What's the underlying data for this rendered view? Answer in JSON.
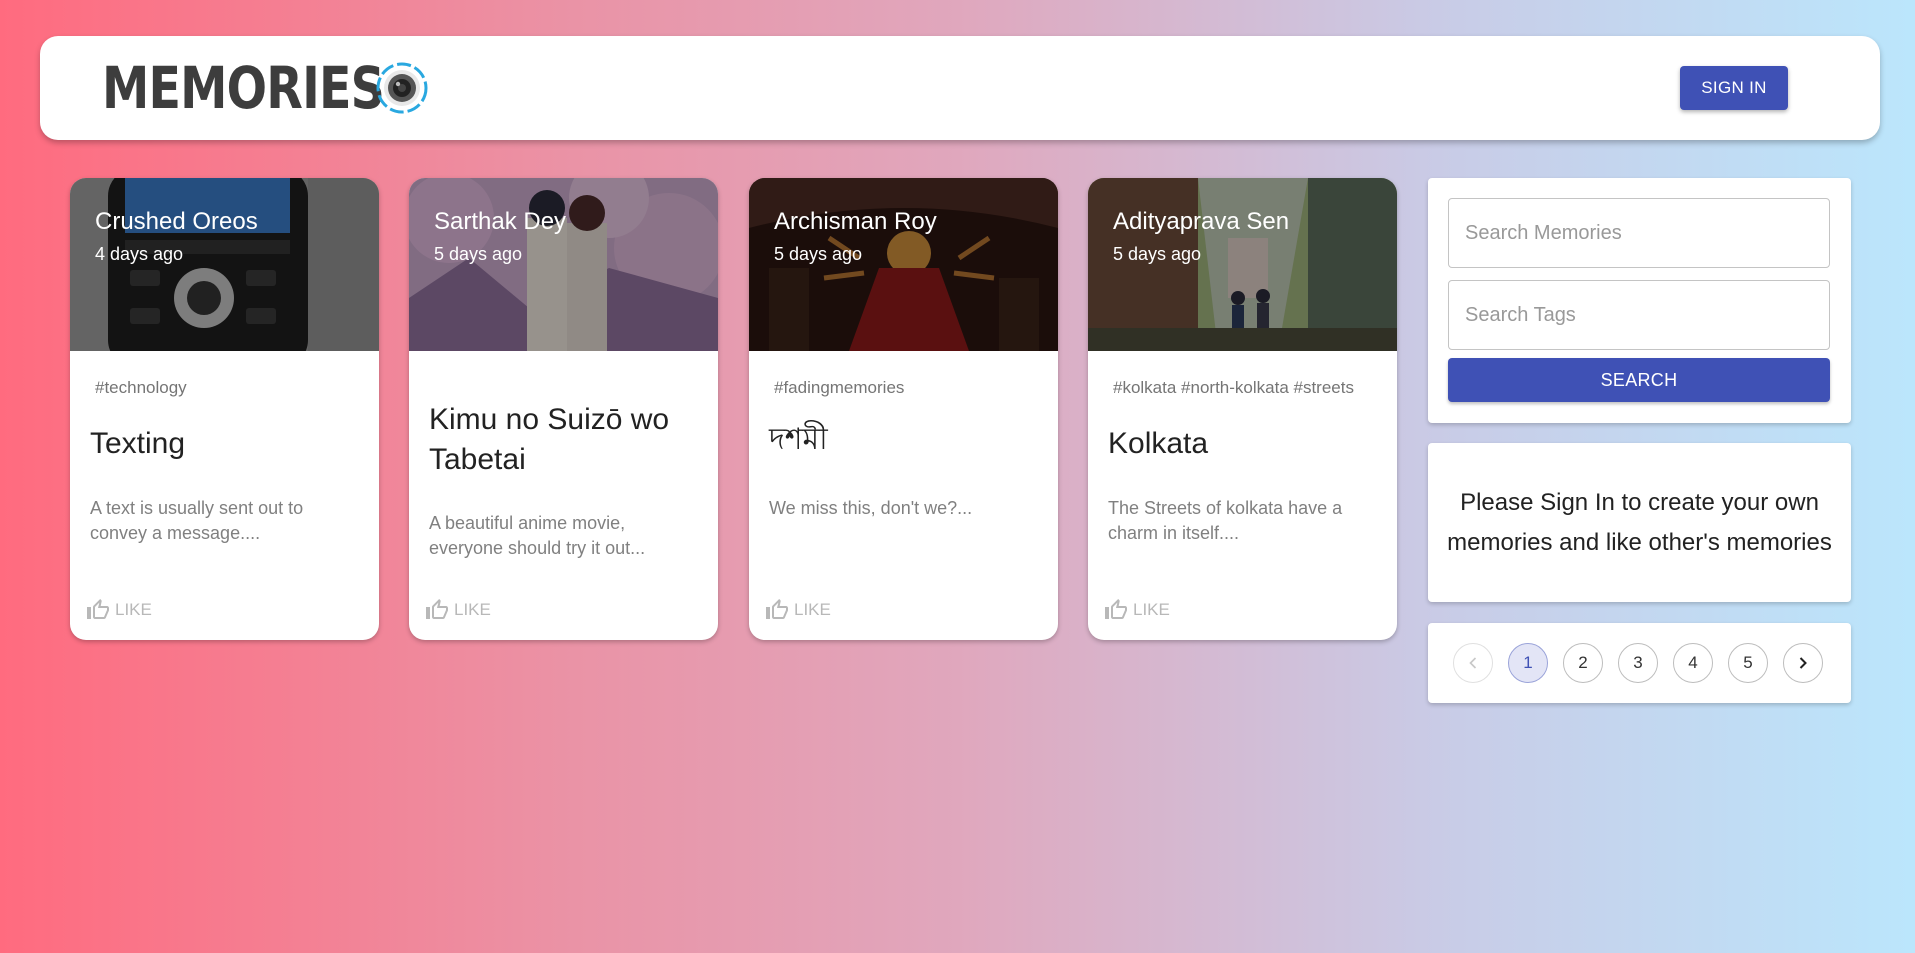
{
  "header": {
    "brand": "MEMORIES",
    "signin_label": "SIGN IN"
  },
  "posts": [
    {
      "author": "Crushed Oreos",
      "time": "4 days ago",
      "tags": "#technology",
      "title": "Texting",
      "message": "A text is usually sent out to convey a message....",
      "like_label": "LIKE"
    },
    {
      "author": "Sarthak Dey",
      "time": "5 days ago",
      "tags": "",
      "title": "Kimu no Suizō wo Tabetai",
      "message": "A beautiful anime movie, everyone should try it out...",
      "like_label": "LIKE"
    },
    {
      "author": "Archisman Roy",
      "time": "5 days ago",
      "tags": "#fadingmemories",
      "title": "দশমী",
      "message": "We miss this, don't we?...",
      "like_label": "LIKE"
    },
    {
      "author": "Adityaprava Sen",
      "time": "5 days ago",
      "tags": "#kolkata #north-kolkata #streets",
      "title": "Kolkata",
      "message": "The Streets of kolkata have a charm in itself....",
      "like_label": "LIKE"
    }
  ],
  "search": {
    "memories_placeholder": "Search Memories",
    "tags_placeholder": "Search Tags",
    "button_label": "SEARCH"
  },
  "signin_notice": "Please Sign In to create your own memories and like other's memories",
  "pagination": {
    "pages": [
      "1",
      "2",
      "3",
      "4",
      "5"
    ],
    "current": "1"
  },
  "colors": {
    "primary": "#3f51b5",
    "gradient_left": "#ff6b7f",
    "gradient_right": "#bbe6fc"
  },
  "icons": {
    "brand": "camera-lens-icon",
    "like": "thumb-up-outline-icon",
    "prev": "chevron-left-icon",
    "next": "chevron-right-icon"
  }
}
